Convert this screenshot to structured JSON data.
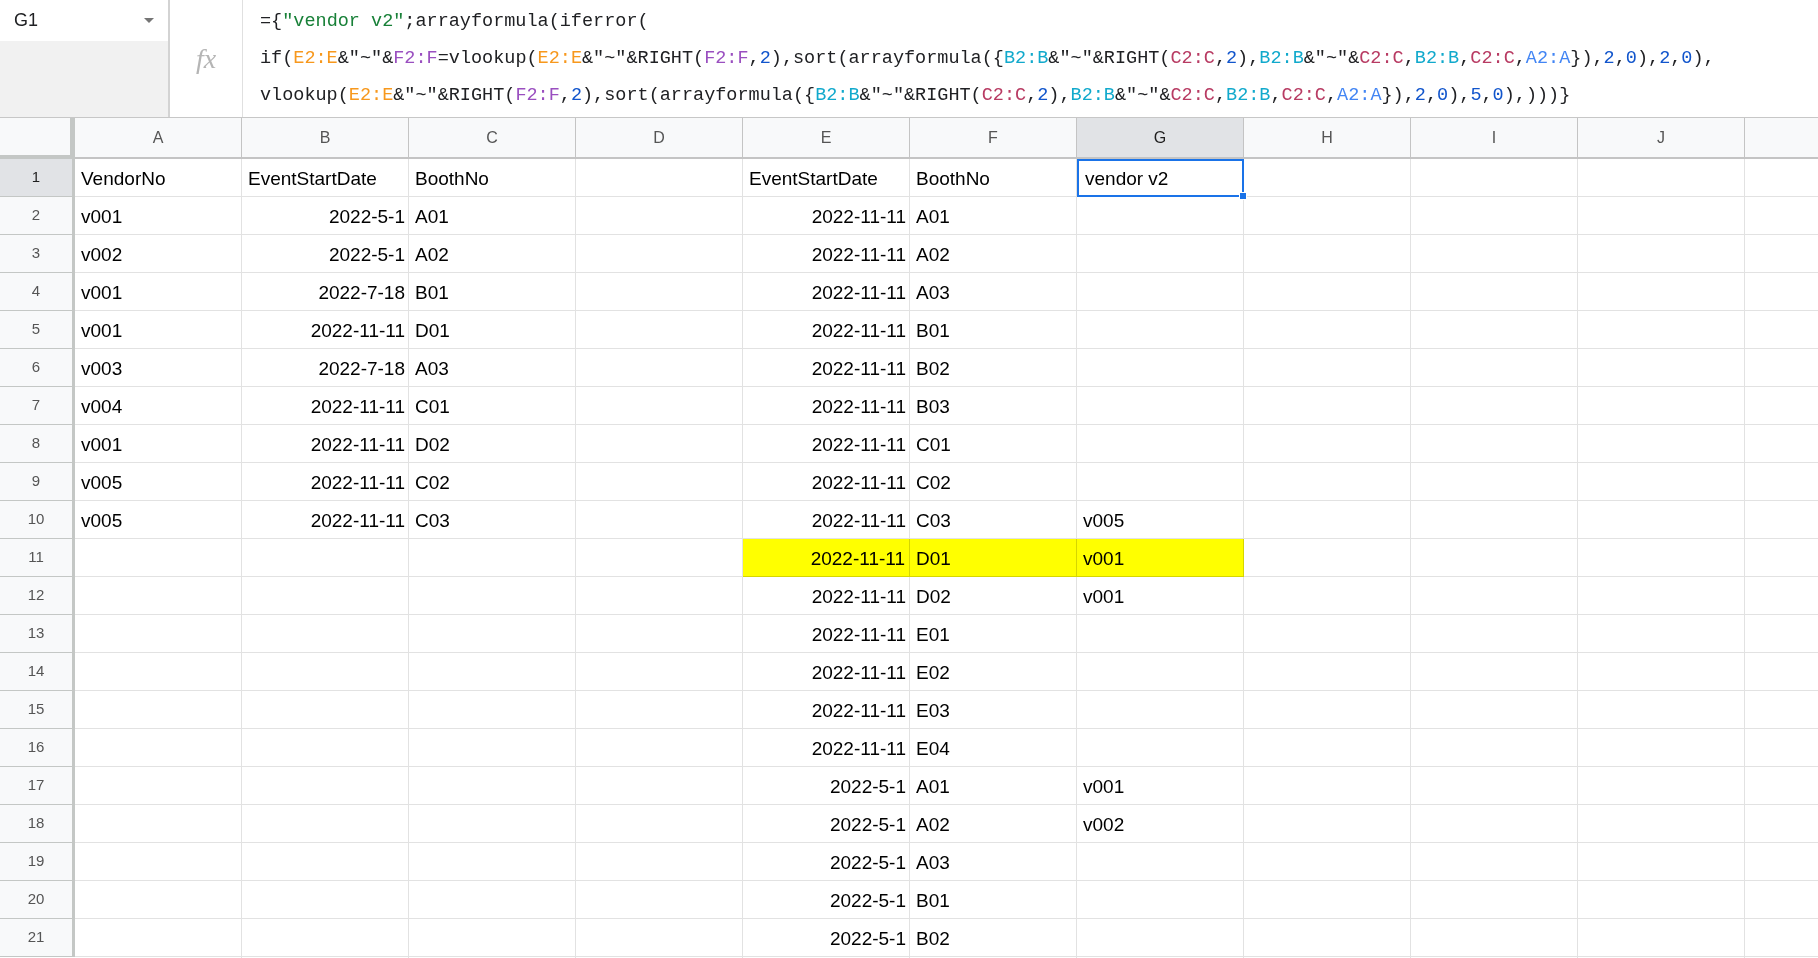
{
  "name_box": {
    "value": "G1"
  },
  "formula_bar": {
    "icon_text": "fx",
    "lines": [
      {
        "tokens": [
          {
            "text": "={"
          },
          {
            "text": "\"vendor v2\"",
            "color": "#188038"
          },
          {
            "text": ";arrayformula(iferror("
          }
        ]
      },
      {
        "tokens": [
          {
            "text": "if("
          },
          {
            "text": "E2:E",
            "color": "#f7981d"
          },
          {
            "text": "&\"~\"&"
          },
          {
            "text": "F2:F",
            "color": "#9a4fc0"
          },
          {
            "text": "=vlookup("
          },
          {
            "text": "E2:E",
            "color": "#f7981d"
          },
          {
            "text": "&\"~\"&RIGHT("
          },
          {
            "text": "F2:F",
            "color": "#9a4fc0"
          },
          {
            "text": ","
          },
          {
            "text": "2",
            "color": "#1155cc"
          },
          {
            "text": "),sort(arrayformula({"
          },
          {
            "text": "B2:B",
            "color": "#11a9cc"
          },
          {
            "text": "&\"~\"&RIGHT("
          },
          {
            "text": "C2:C",
            "color": "#b83b63"
          },
          {
            "text": ","
          },
          {
            "text": "2",
            "color": "#1155cc"
          },
          {
            "text": "),"
          },
          {
            "text": "B2:B",
            "color": "#11a9cc"
          },
          {
            "text": "&\"~\"&"
          },
          {
            "text": "C2:C",
            "color": "#b83b63"
          },
          {
            "text": ","
          },
          {
            "text": "B2:B",
            "color": "#11a9cc"
          },
          {
            "text": ","
          },
          {
            "text": "C2:C",
            "color": "#b83b63"
          },
          {
            "text": ","
          },
          {
            "text": "A2:A",
            "color": "#4285f4"
          },
          {
            "text": "}),"
          },
          {
            "text": "2",
            "color": "#1155cc"
          },
          {
            "text": ","
          },
          {
            "text": "0",
            "color": "#1155cc"
          },
          {
            "text": "),"
          },
          {
            "text": "2",
            "color": "#1155cc"
          },
          {
            "text": ","
          },
          {
            "text": "0",
            "color": "#1155cc"
          },
          {
            "text": "),"
          }
        ]
      },
      {
        "tokens": [
          {
            "text": "vlookup("
          },
          {
            "text": "E2:E",
            "color": "#f7981d"
          },
          {
            "text": "&\"~\"&RIGHT("
          },
          {
            "text": "F2:F",
            "color": "#9a4fc0"
          },
          {
            "text": ","
          },
          {
            "text": "2",
            "color": "#1155cc"
          },
          {
            "text": "),sort(arrayformula({"
          },
          {
            "text": "B2:B",
            "color": "#11a9cc"
          },
          {
            "text": "&\"~\"&RIGHT("
          },
          {
            "text": "C2:C",
            "color": "#b83b63"
          },
          {
            "text": ","
          },
          {
            "text": "2",
            "color": "#1155cc"
          },
          {
            "text": "),"
          },
          {
            "text": "B2:B",
            "color": "#11a9cc"
          },
          {
            "text": "&\"~\"&"
          },
          {
            "text": "C2:C",
            "color": "#b83b63"
          },
          {
            "text": ","
          },
          {
            "text": "B2:B",
            "color": "#11a9cc"
          },
          {
            "text": ","
          },
          {
            "text": "C2:C",
            "color": "#b83b63"
          },
          {
            "text": ","
          },
          {
            "text": "A2:A",
            "color": "#4285f4"
          },
          {
            "text": "}),"
          },
          {
            "text": "2",
            "color": "#1155cc"
          },
          {
            "text": ","
          },
          {
            "text": "0",
            "color": "#1155cc"
          },
          {
            "text": "),"
          },
          {
            "text": "5",
            "color": "#1155cc"
          },
          {
            "text": ","
          },
          {
            "text": "0",
            "color": "#1155cc"
          },
          {
            "text": "),)))}"
          }
        ]
      }
    ]
  },
  "columns": [
    {
      "label": "A",
      "selected": false
    },
    {
      "label": "B",
      "selected": false
    },
    {
      "label": "C",
      "selected": false
    },
    {
      "label": "D",
      "selected": false
    },
    {
      "label": "E",
      "selected": false
    },
    {
      "label": "F",
      "selected": false
    },
    {
      "label": "G",
      "selected": true
    },
    {
      "label": "H",
      "selected": false
    },
    {
      "label": "I",
      "selected": false
    },
    {
      "label": "J",
      "selected": false
    }
  ],
  "rows": [
    {
      "number": "1",
      "selected": true,
      "highlighted": false,
      "cells": [
        {
          "kind": "text",
          "text": "VendorNo"
        },
        {
          "kind": "text",
          "text": "EventStartDate"
        },
        {
          "kind": "text",
          "text": "BoothNo"
        },
        null,
        {
          "kind": "text",
          "text": "EventStartDate"
        },
        {
          "kind": "text",
          "text": "BoothNo"
        },
        {
          "kind": "text",
          "text": "vendor v2"
        }
      ]
    },
    {
      "number": "2",
      "selected": false,
      "highlighted": false,
      "cells": [
        {
          "kind": "text",
          "text": "v001"
        },
        {
          "kind": "date",
          "text": "2022-5-1"
        },
        {
          "kind": "text",
          "text": "A01"
        },
        null,
        {
          "kind": "date",
          "text": "2022-11-11"
        },
        {
          "kind": "text",
          "text": "A01"
        }
      ]
    },
    {
      "number": "3",
      "selected": false,
      "highlighted": false,
      "cells": [
        {
          "kind": "text",
          "text": "v002"
        },
        {
          "kind": "date",
          "text": "2022-5-1"
        },
        {
          "kind": "text",
          "text": "A02"
        },
        null,
        {
          "kind": "date",
          "text": "2022-11-11"
        },
        {
          "kind": "text",
          "text": "A02"
        }
      ]
    },
    {
      "number": "4",
      "selected": false,
      "highlighted": false,
      "cells": [
        {
          "kind": "text",
          "text": "v001"
        },
        {
          "kind": "date",
          "text": "2022-7-18"
        },
        {
          "kind": "text",
          "text": "B01"
        },
        null,
        {
          "kind": "date",
          "text": "2022-11-11"
        },
        {
          "kind": "text",
          "text": "A03"
        }
      ]
    },
    {
      "number": "5",
      "selected": false,
      "highlighted": false,
      "cells": [
        {
          "kind": "text",
          "text": "v001"
        },
        {
          "kind": "date",
          "text": "2022-11-11"
        },
        {
          "kind": "text",
          "text": "D01"
        },
        null,
        {
          "kind": "date",
          "text": "2022-11-11"
        },
        {
          "kind": "text",
          "text": "B01"
        }
      ]
    },
    {
      "number": "6",
      "selected": false,
      "highlighted": false,
      "cells": [
        {
          "kind": "text",
          "text": "v003"
        },
        {
          "kind": "date",
          "text": "2022-7-18"
        },
        {
          "kind": "text",
          "text": "A03"
        },
        null,
        {
          "kind": "date",
          "text": "2022-11-11"
        },
        {
          "kind": "text",
          "text": "B02"
        }
      ]
    },
    {
      "number": "7",
      "selected": false,
      "highlighted": false,
      "cells": [
        {
          "kind": "text",
          "text": "v004"
        },
        {
          "kind": "date",
          "text": "2022-11-11"
        },
        {
          "kind": "text",
          "text": "C01"
        },
        null,
        {
          "kind": "date",
          "text": "2022-11-11"
        },
        {
          "kind": "text",
          "text": "B03"
        }
      ]
    },
    {
      "number": "8",
      "selected": false,
      "highlighted": false,
      "cells": [
        {
          "kind": "text",
          "text": "v001"
        },
        {
          "kind": "date",
          "text": "2022-11-11"
        },
        {
          "kind": "text",
          "text": "D02"
        },
        null,
        {
          "kind": "date",
          "text": "2022-11-11"
        },
        {
          "kind": "text",
          "text": "C01"
        }
      ]
    },
    {
      "number": "9",
      "selected": false,
      "highlighted": false,
      "cells": [
        {
          "kind": "text",
          "text": "v005"
        },
        {
          "kind": "date",
          "text": "2022-11-11"
        },
        {
          "kind": "text",
          "text": "C02"
        },
        null,
        {
          "kind": "date",
          "text": "2022-11-11"
        },
        {
          "kind": "text",
          "text": "C02"
        }
      ]
    },
    {
      "number": "10",
      "selected": false,
      "highlighted": false,
      "cells": [
        {
          "kind": "text",
          "text": "v005"
        },
        {
          "kind": "date",
          "text": "2022-11-11"
        },
        {
          "kind": "text",
          "text": "C03"
        },
        null,
        {
          "kind": "date",
          "text": "2022-11-11"
        },
        {
          "kind": "text",
          "text": "C03"
        },
        {
          "kind": "text",
          "text": "v005"
        }
      ]
    },
    {
      "number": "11",
      "selected": false,
      "highlighted": true,
      "cells": [
        null,
        null,
        null,
        null,
        {
          "kind": "date",
          "text": "2022-11-11"
        },
        {
          "kind": "text",
          "text": "D01"
        },
        {
          "kind": "text",
          "text": "v001"
        }
      ]
    },
    {
      "number": "12",
      "selected": false,
      "highlighted": false,
      "cells": [
        null,
        null,
        null,
        null,
        {
          "kind": "date",
          "text": "2022-11-11"
        },
        {
          "kind": "text",
          "text": "D02"
        },
        {
          "kind": "text",
          "text": "v001"
        }
      ]
    },
    {
      "number": "13",
      "selected": false,
      "highlighted": false,
      "cells": [
        null,
        null,
        null,
        null,
        {
          "kind": "date",
          "text": "2022-11-11"
        },
        {
          "kind": "text",
          "text": "E01"
        }
      ]
    },
    {
      "number": "14",
      "selected": false,
      "highlighted": false,
      "cells": [
        null,
        null,
        null,
        null,
        {
          "kind": "date",
          "text": "2022-11-11"
        },
        {
          "kind": "text",
          "text": "E02"
        }
      ]
    },
    {
      "number": "15",
      "selected": false,
      "highlighted": false,
      "cells": [
        null,
        null,
        null,
        null,
        {
          "kind": "date",
          "text": "2022-11-11"
        },
        {
          "kind": "text",
          "text": "E03"
        }
      ]
    },
    {
      "number": "16",
      "selected": false,
      "highlighted": false,
      "cells": [
        null,
        null,
        null,
        null,
        {
          "kind": "date",
          "text": "2022-11-11"
        },
        {
          "kind": "text",
          "text": "E04"
        }
      ]
    },
    {
      "number": "17",
      "selected": false,
      "highlighted": false,
      "cells": [
        null,
        null,
        null,
        null,
        {
          "kind": "date",
          "text": "2022-5-1"
        },
        {
          "kind": "text",
          "text": "A01"
        },
        {
          "kind": "text",
          "text": "v001"
        }
      ]
    },
    {
      "number": "18",
      "selected": false,
      "highlighted": false,
      "cells": [
        null,
        null,
        null,
        null,
        {
          "kind": "date",
          "text": "2022-5-1"
        },
        {
          "kind": "text",
          "text": "A02"
        },
        {
          "kind": "text",
          "text": "v002"
        }
      ]
    },
    {
      "number": "19",
      "selected": false,
      "highlighted": false,
      "cells": [
        null,
        null,
        null,
        null,
        {
          "kind": "date",
          "text": "2022-5-1"
        },
        {
          "kind": "text",
          "text": "A03"
        }
      ]
    },
    {
      "number": "20",
      "selected": false,
      "highlighted": false,
      "cells": [
        null,
        null,
        null,
        null,
        {
          "kind": "date",
          "text": "2022-5-1"
        },
        {
          "kind": "text",
          "text": "B01"
        }
      ]
    },
    {
      "number": "21",
      "selected": false,
      "highlighted": false,
      "cells": [
        null,
        null,
        null,
        null,
        {
          "kind": "date",
          "text": "2022-5-1"
        },
        {
          "kind": "text",
          "text": "B02"
        }
      ]
    }
  ]
}
